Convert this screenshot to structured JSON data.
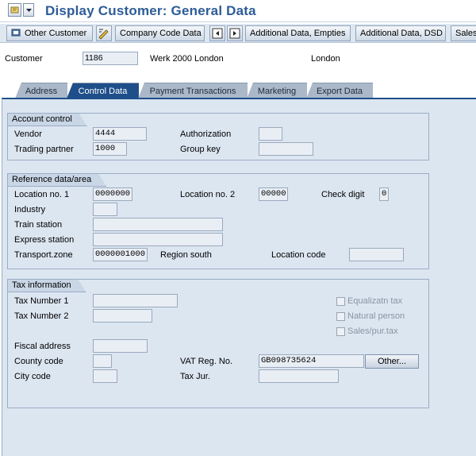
{
  "window": {
    "title": "Display Customer: General Data"
  },
  "toolbar": {
    "other_customer": "Other Customer",
    "company_code_data": "Company Code Data",
    "additional_data_empties": "Additional Data, Empties",
    "additional_data_dsd": "Additional Data, DSD",
    "sales": "Sales"
  },
  "header": {
    "customer_label": "Customer",
    "customer_value": "1186",
    "customer_name": "Werk 2000 London",
    "customer_city": "London"
  },
  "tabs": [
    "Address",
    "Control Data",
    "Payment Transactions",
    "Marketing",
    "Export Data"
  ],
  "active_tab": "Control Data",
  "account_control": {
    "title": "Account control",
    "vendor_label": "Vendor",
    "vendor_value": "4444",
    "trading_partner_label": "Trading partner",
    "trading_partner_value": "1000",
    "authorization_label": "Authorization",
    "authorization_value": "",
    "group_key_label": "Group key",
    "group_key_value": ""
  },
  "reference_data": {
    "title": "Reference data/area",
    "location_no1_label": "Location no. 1",
    "location_no1_value": "0000000",
    "location_no2_label": "Location no. 2",
    "location_no2_value": "00000",
    "check_digit_label": "Check digit",
    "check_digit_value": "0",
    "industry_label": "Industry",
    "train_station_label": "Train station",
    "express_station_label": "Express station",
    "transport_zone_label": "Transport.zone",
    "transport_zone_value": "0000001000",
    "region_text": "Region south",
    "location_code_label": "Location code"
  },
  "tax_information": {
    "title": "Tax information",
    "tax_number1_label": "Tax Number 1",
    "tax_number2_label": "Tax Number 2",
    "fiscal_address_label": "Fiscal address",
    "county_code_label": "County code",
    "city_code_label": "City code",
    "vat_reg_label": "VAT Reg. No.",
    "vat_reg_value": "GB098735624",
    "tax_jur_label": "Tax Jur.",
    "other_button": "Other...",
    "equalization_tax_label": "Equalizatn tax",
    "natural_person_label": "Natural person",
    "sales_pur_tax_label": "Sales/pur.tax"
  },
  "colors": {
    "title": "#2d5c98",
    "active_tab": "#1f4f8a",
    "panel": "#dce6f1"
  }
}
